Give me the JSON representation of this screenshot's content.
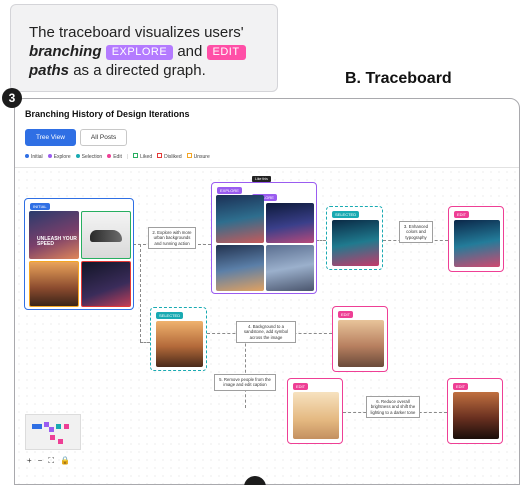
{
  "caption": {
    "line1": "The traceboard visualizes users'",
    "word_branching": "branching",
    "tag_explore": "EXPLORE",
    "word_and": "and",
    "tag_edit": "EDIT",
    "word_paths": "paths",
    "line3_rest": "as a directed graph."
  },
  "section_label": "B. Traceboard",
  "step_number": "3",
  "panel": {
    "title": "Branching History of Design Iterations",
    "tabs": [
      "Tree View",
      "All Posts"
    ],
    "legend": [
      "Initial",
      "Explore",
      "Selection",
      "Edit",
      "Liked",
      "Disliked",
      "Unsure"
    ]
  },
  "nodes": {
    "initial_tag": "INITIAL",
    "explore_tag": "EXPLORE",
    "explore_tag2": "EXPLORE",
    "selected_tag": "SELECTED",
    "edit_tag": "EDIT"
  },
  "poster_text": {
    "unleash": "UNLEASH YOUR SPEED"
  },
  "notes": {
    "n1": "2. Explore with more urban backgrounds and running action",
    "n2": "3. Enhanced colors and typography",
    "n3": "4. Background to a sandstone, add symbol across the image",
    "n4": "5. Remove people from the image and edit caption",
    "n5": "6. Reduce overall brightness and shift the lighting to a darker tone"
  },
  "tooltip_chip": "Like this",
  "zoom_controls": [
    "+",
    "−",
    "⛶",
    "🔒"
  ],
  "colors": {
    "initial": "#2f6fe4",
    "explore": "#9a5cf0",
    "selected": "#19aab2",
    "edit": "#ee3f95",
    "liked": "#27ae60",
    "disliked": "#e53935",
    "unsure": "#f5a623"
  }
}
